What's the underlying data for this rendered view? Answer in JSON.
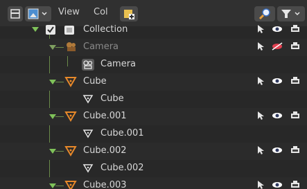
{
  "header": {
    "menus": [
      "View",
      "Col"
    ]
  },
  "rows": [
    {
      "label": "Collection",
      "type": "collection"
    },
    {
      "label": "Camera",
      "type": "object",
      "dim": true
    },
    {
      "label": "Camera",
      "type": "data"
    },
    {
      "label": "Cube",
      "type": "object"
    },
    {
      "label": "Cube",
      "type": "data"
    },
    {
      "label": "Cube.001",
      "type": "object"
    },
    {
      "label": "Cube.001",
      "type": "data"
    },
    {
      "label": "Cube.002",
      "type": "object"
    },
    {
      "label": "Cube.002",
      "type": "data"
    },
    {
      "label": "Cube.003",
      "type": "object"
    }
  ],
  "colors": {
    "background": "#282828",
    "header": "#303030",
    "tree_line": "#6a8a4a",
    "mesh_icon": "#e8892a",
    "camera_icon": "#b07a3a",
    "visibility_eye": "#ffffff",
    "hidden_eye": "#d0303a"
  }
}
